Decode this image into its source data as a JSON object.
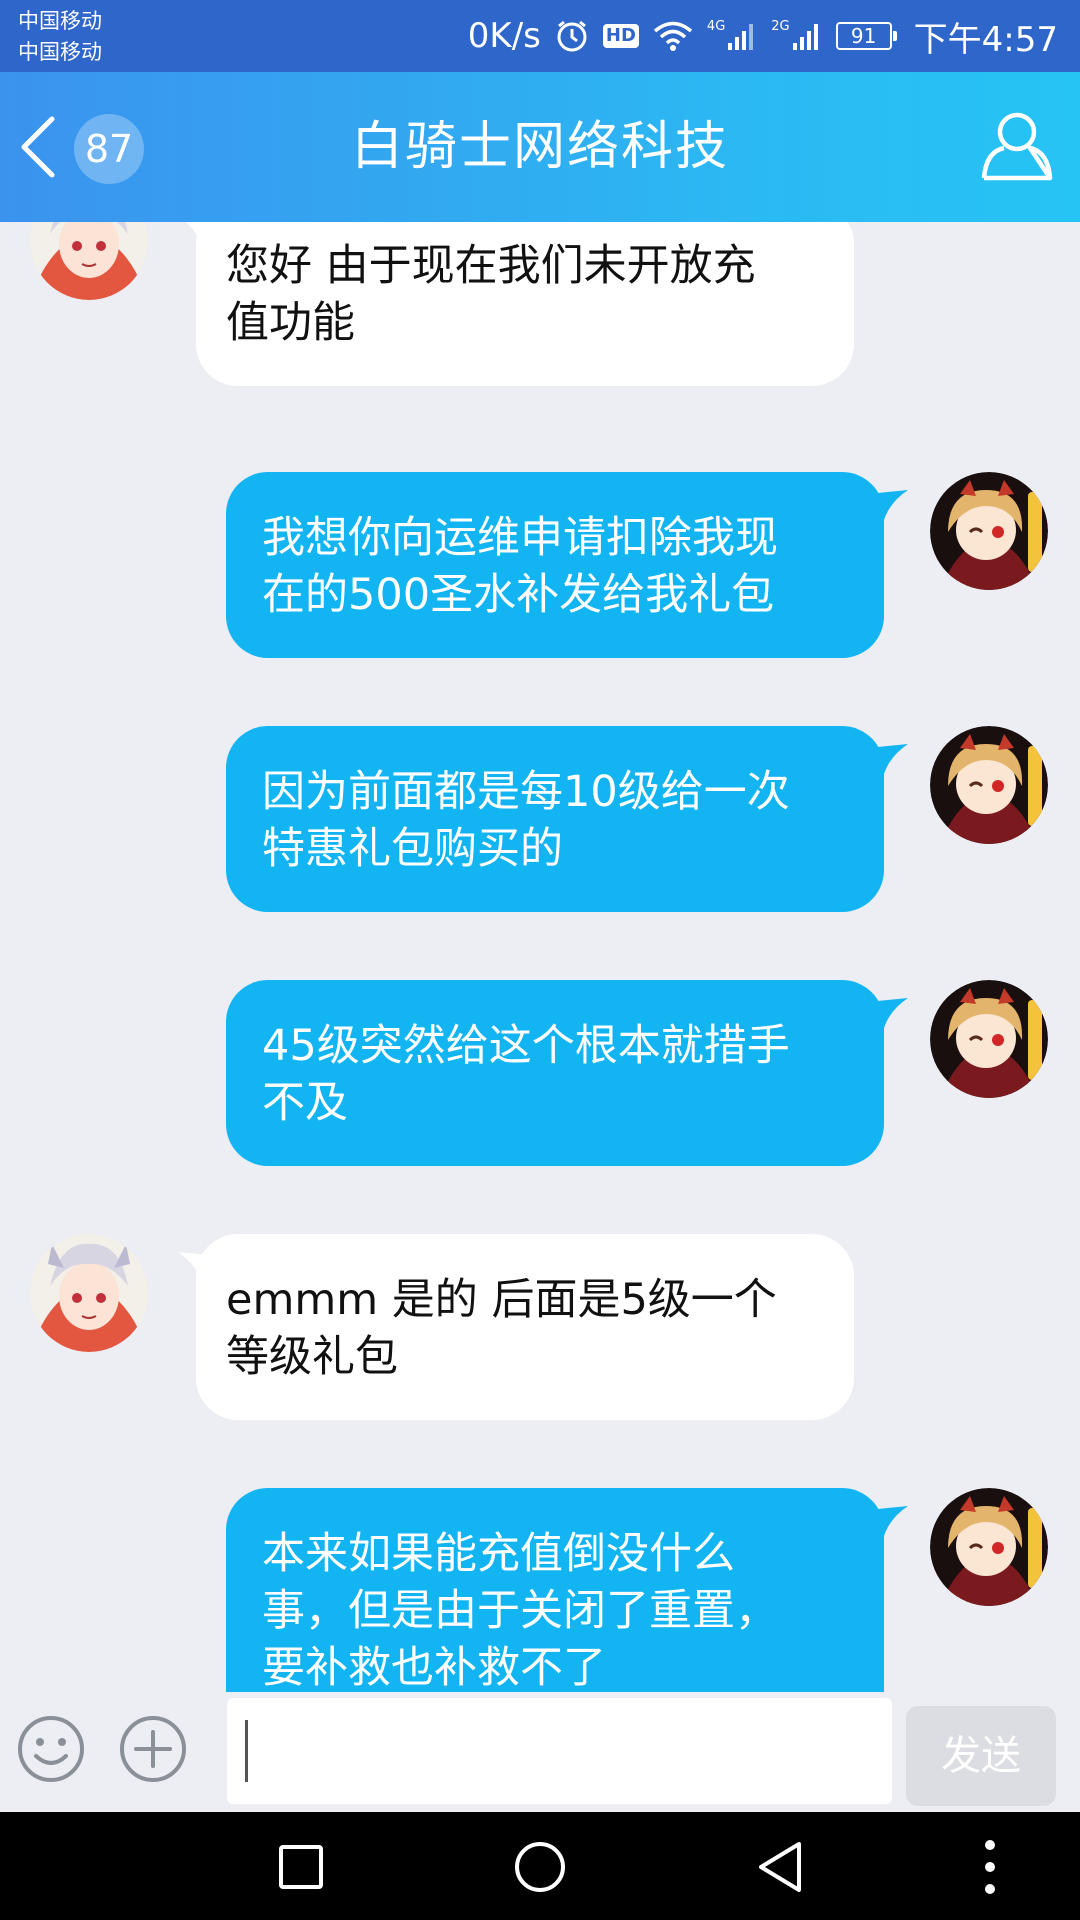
{
  "status_bar": {
    "carrier_1": "中国移动",
    "carrier_2": "中国移动",
    "net_speed": "0K/s",
    "hd_label": "HD",
    "net_4g": "4G",
    "net_2g": "2G",
    "battery": "91",
    "time": "下午4:57",
    "icons": [
      "alarm-icon",
      "wifi-icon",
      "signal-icon",
      "battery-icon"
    ]
  },
  "header": {
    "unread_count": "87",
    "title": "白骑士网络科技",
    "icons": [
      "back-chevron-icon",
      "profile-icon"
    ],
    "gradient_from": "#3b93ee",
    "gradient_to": "#26c4f4"
  },
  "messages": [
    {
      "side": "in",
      "lines": [
        "您好 由于现在我们未开放充",
        "值功能"
      ]
    },
    {
      "side": "out",
      "lines": [
        "我想你向运维申请扣除我现",
        "在的500圣水补发给我礼包"
      ]
    },
    {
      "side": "out",
      "lines": [
        "因为前面都是每10级给一次",
        "特惠礼包购买的"
      ]
    },
    {
      "side": "out",
      "lines": [
        "45级突然给这个根本就措手",
        "不及"
      ]
    },
    {
      "side": "in",
      "lines": [
        "emmm 是的 后面是5级一个",
        "等级礼包"
      ]
    },
    {
      "side": "out",
      "lines": [
        "本来如果能充值倒没什么",
        "事，但是由于关闭了重置，",
        "要补救也补救不了"
      ]
    }
  ],
  "colors": {
    "bubble_out": "#12b4f2",
    "bubble_in": "#ffffff",
    "background": "#eceef3"
  },
  "input_bar": {
    "placeholder": "",
    "value": "",
    "send_label": "发送",
    "icons": [
      "emoji-icon",
      "plus-circle-icon"
    ]
  },
  "nav_bar": {
    "icons": [
      "recents-square-icon",
      "home-circle-icon",
      "back-triangle-icon",
      "more-dots-icon"
    ]
  }
}
